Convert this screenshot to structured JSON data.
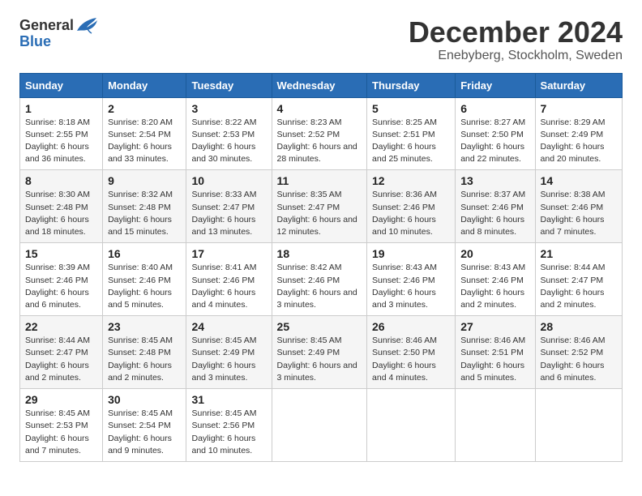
{
  "logo": {
    "general": "General",
    "blue": "Blue"
  },
  "title": "December 2024",
  "subtitle": "Enebyberg, Stockholm, Sweden",
  "headers": [
    "Sunday",
    "Monday",
    "Tuesday",
    "Wednesday",
    "Thursday",
    "Friday",
    "Saturday"
  ],
  "weeks": [
    [
      {
        "day": "1",
        "sunrise": "Sunrise: 8:18 AM",
        "sunset": "Sunset: 2:55 PM",
        "daylight": "Daylight: 6 hours and 36 minutes."
      },
      {
        "day": "2",
        "sunrise": "Sunrise: 8:20 AM",
        "sunset": "Sunset: 2:54 PM",
        "daylight": "Daylight: 6 hours and 33 minutes."
      },
      {
        "day": "3",
        "sunrise": "Sunrise: 8:22 AM",
        "sunset": "Sunset: 2:53 PM",
        "daylight": "Daylight: 6 hours and 30 minutes."
      },
      {
        "day": "4",
        "sunrise": "Sunrise: 8:23 AM",
        "sunset": "Sunset: 2:52 PM",
        "daylight": "Daylight: 6 hours and 28 minutes."
      },
      {
        "day": "5",
        "sunrise": "Sunrise: 8:25 AM",
        "sunset": "Sunset: 2:51 PM",
        "daylight": "Daylight: 6 hours and 25 minutes."
      },
      {
        "day": "6",
        "sunrise": "Sunrise: 8:27 AM",
        "sunset": "Sunset: 2:50 PM",
        "daylight": "Daylight: 6 hours and 22 minutes."
      },
      {
        "day": "7",
        "sunrise": "Sunrise: 8:29 AM",
        "sunset": "Sunset: 2:49 PM",
        "daylight": "Daylight: 6 hours and 20 minutes."
      }
    ],
    [
      {
        "day": "8",
        "sunrise": "Sunrise: 8:30 AM",
        "sunset": "Sunset: 2:48 PM",
        "daylight": "Daylight: 6 hours and 18 minutes."
      },
      {
        "day": "9",
        "sunrise": "Sunrise: 8:32 AM",
        "sunset": "Sunset: 2:48 PM",
        "daylight": "Daylight: 6 hours and 15 minutes."
      },
      {
        "day": "10",
        "sunrise": "Sunrise: 8:33 AM",
        "sunset": "Sunset: 2:47 PM",
        "daylight": "Daylight: 6 hours and 13 minutes."
      },
      {
        "day": "11",
        "sunrise": "Sunrise: 8:35 AM",
        "sunset": "Sunset: 2:47 PM",
        "daylight": "Daylight: 6 hours and 12 minutes."
      },
      {
        "day": "12",
        "sunrise": "Sunrise: 8:36 AM",
        "sunset": "Sunset: 2:46 PM",
        "daylight": "Daylight: 6 hours and 10 minutes."
      },
      {
        "day": "13",
        "sunrise": "Sunrise: 8:37 AM",
        "sunset": "Sunset: 2:46 PM",
        "daylight": "Daylight: 6 hours and 8 minutes."
      },
      {
        "day": "14",
        "sunrise": "Sunrise: 8:38 AM",
        "sunset": "Sunset: 2:46 PM",
        "daylight": "Daylight: 6 hours and 7 minutes."
      }
    ],
    [
      {
        "day": "15",
        "sunrise": "Sunrise: 8:39 AM",
        "sunset": "Sunset: 2:46 PM",
        "daylight": "Daylight: 6 hours and 6 minutes."
      },
      {
        "day": "16",
        "sunrise": "Sunrise: 8:40 AM",
        "sunset": "Sunset: 2:46 PM",
        "daylight": "Daylight: 6 hours and 5 minutes."
      },
      {
        "day": "17",
        "sunrise": "Sunrise: 8:41 AM",
        "sunset": "Sunset: 2:46 PM",
        "daylight": "Daylight: 6 hours and 4 minutes."
      },
      {
        "day": "18",
        "sunrise": "Sunrise: 8:42 AM",
        "sunset": "Sunset: 2:46 PM",
        "daylight": "Daylight: 6 hours and 3 minutes."
      },
      {
        "day": "19",
        "sunrise": "Sunrise: 8:43 AM",
        "sunset": "Sunset: 2:46 PM",
        "daylight": "Daylight: 6 hours and 3 minutes."
      },
      {
        "day": "20",
        "sunrise": "Sunrise: 8:43 AM",
        "sunset": "Sunset: 2:46 PM",
        "daylight": "Daylight: 6 hours and 2 minutes."
      },
      {
        "day": "21",
        "sunrise": "Sunrise: 8:44 AM",
        "sunset": "Sunset: 2:47 PM",
        "daylight": "Daylight: 6 hours and 2 minutes."
      }
    ],
    [
      {
        "day": "22",
        "sunrise": "Sunrise: 8:44 AM",
        "sunset": "Sunset: 2:47 PM",
        "daylight": "Daylight: 6 hours and 2 minutes."
      },
      {
        "day": "23",
        "sunrise": "Sunrise: 8:45 AM",
        "sunset": "Sunset: 2:48 PM",
        "daylight": "Daylight: 6 hours and 2 minutes."
      },
      {
        "day": "24",
        "sunrise": "Sunrise: 8:45 AM",
        "sunset": "Sunset: 2:49 PM",
        "daylight": "Daylight: 6 hours and 3 minutes."
      },
      {
        "day": "25",
        "sunrise": "Sunrise: 8:45 AM",
        "sunset": "Sunset: 2:49 PM",
        "daylight": "Daylight: 6 hours and 3 minutes."
      },
      {
        "day": "26",
        "sunrise": "Sunrise: 8:46 AM",
        "sunset": "Sunset: 2:50 PM",
        "daylight": "Daylight: 6 hours and 4 minutes."
      },
      {
        "day": "27",
        "sunrise": "Sunrise: 8:46 AM",
        "sunset": "Sunset: 2:51 PM",
        "daylight": "Daylight: 6 hours and 5 minutes."
      },
      {
        "day": "28",
        "sunrise": "Sunrise: 8:46 AM",
        "sunset": "Sunset: 2:52 PM",
        "daylight": "Daylight: 6 hours and 6 minutes."
      }
    ],
    [
      {
        "day": "29",
        "sunrise": "Sunrise: 8:45 AM",
        "sunset": "Sunset: 2:53 PM",
        "daylight": "Daylight: 6 hours and 7 minutes."
      },
      {
        "day": "30",
        "sunrise": "Sunrise: 8:45 AM",
        "sunset": "Sunset: 2:54 PM",
        "daylight": "Daylight: 6 hours and 9 minutes."
      },
      {
        "day": "31",
        "sunrise": "Sunrise: 8:45 AM",
        "sunset": "Sunset: 2:56 PM",
        "daylight": "Daylight: 6 hours and 10 minutes."
      },
      null,
      null,
      null,
      null
    ]
  ]
}
